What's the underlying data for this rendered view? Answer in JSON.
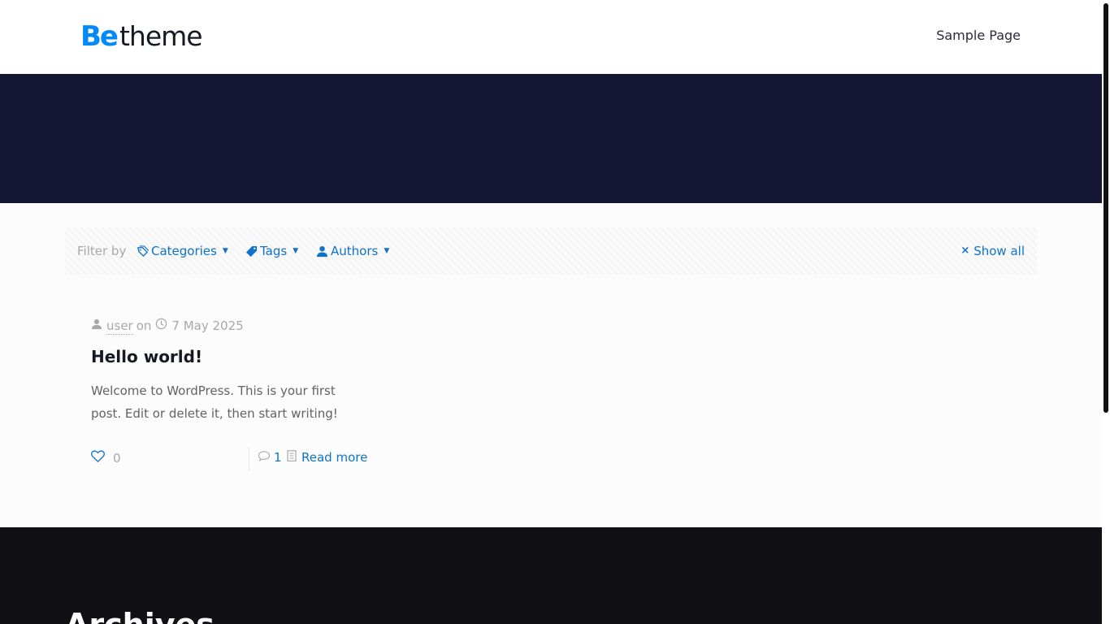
{
  "header": {
    "logo": {
      "part1": "Be",
      "part2": "theme"
    },
    "nav": [
      {
        "label": "Sample Page"
      }
    ]
  },
  "filters": {
    "label": "Filter by",
    "items": [
      {
        "label": "Categories",
        "icon": "categories-icon"
      },
      {
        "label": "Tags",
        "icon": "tag-icon"
      },
      {
        "label": "Authors",
        "icon": "user-icon"
      }
    ],
    "show_all": "Show all"
  },
  "post": {
    "author": "user",
    "on": "on",
    "date": "7 May 2025",
    "title": "Hello world!",
    "excerpt": "Welcome to WordPress. This is your first post. Edit or delete it, then start writing!",
    "likes": "0",
    "comments": "1",
    "read_more": "Read more"
  },
  "footer": {
    "heading": "Archives"
  },
  "colors": {
    "accent": "#0089f7",
    "link": "#0e73c9",
    "hero_bg": "#131733",
    "footer_bg": "#101015"
  }
}
